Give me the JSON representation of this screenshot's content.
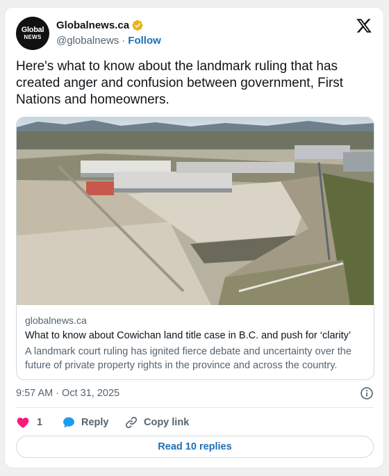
{
  "author": {
    "display_name": "Globalnews.ca",
    "handle": "@globalnews",
    "separator": "·",
    "follow_label": "Follow",
    "avatar_logo_line1": "Global",
    "avatar_logo_line2": "NEWS",
    "verified_badge": "gold-verified-icon"
  },
  "tweet": {
    "text": "Here's what to know about the landmark ruling that has created anger and confusion between government, First Nations and homeowners."
  },
  "link_card": {
    "domain": "globalnews.ca",
    "title": "What to know about Cowichan land title case in B.C. and push for ‘clarity’",
    "description": "A landmark court ruling has ignited fierce debate and uncertainty over the future of private property rights in the province and across the country.",
    "image": "aerial-photo-industrial-land"
  },
  "meta": {
    "time": "9:57 AM",
    "separator": "·",
    "date": "Oct 31, 2025"
  },
  "actions": {
    "like_count": "1",
    "reply_label": "Reply",
    "copy_link_label": "Copy link"
  },
  "read_replies_label": "Read 10 replies",
  "colors": {
    "like": "#f91880",
    "reply": "#1d9bf0",
    "link": "#1d6fb8",
    "verified": "#e2b719"
  }
}
